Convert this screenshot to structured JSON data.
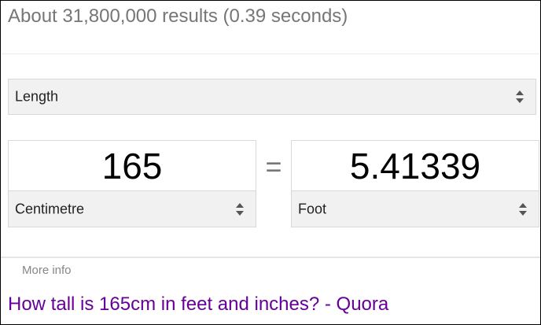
{
  "results_stats": "About 31,800,000 results (0.39 seconds)",
  "converter": {
    "unit_type": "Length",
    "from": {
      "value": "165",
      "unit": "Centimetre"
    },
    "equals": "=",
    "to": {
      "value": "5.41339",
      "unit": "Foot"
    }
  },
  "more_info": "More info",
  "result": {
    "title": "How tall is 165cm in feet and inches? - Quora"
  },
  "colors": {
    "visited_link": "#660099",
    "muted_text": "#767676",
    "select_bg": "#f1f1f1",
    "border": "#d9d9d9"
  },
  "icons": [
    "up-down-arrows-icon"
  ]
}
